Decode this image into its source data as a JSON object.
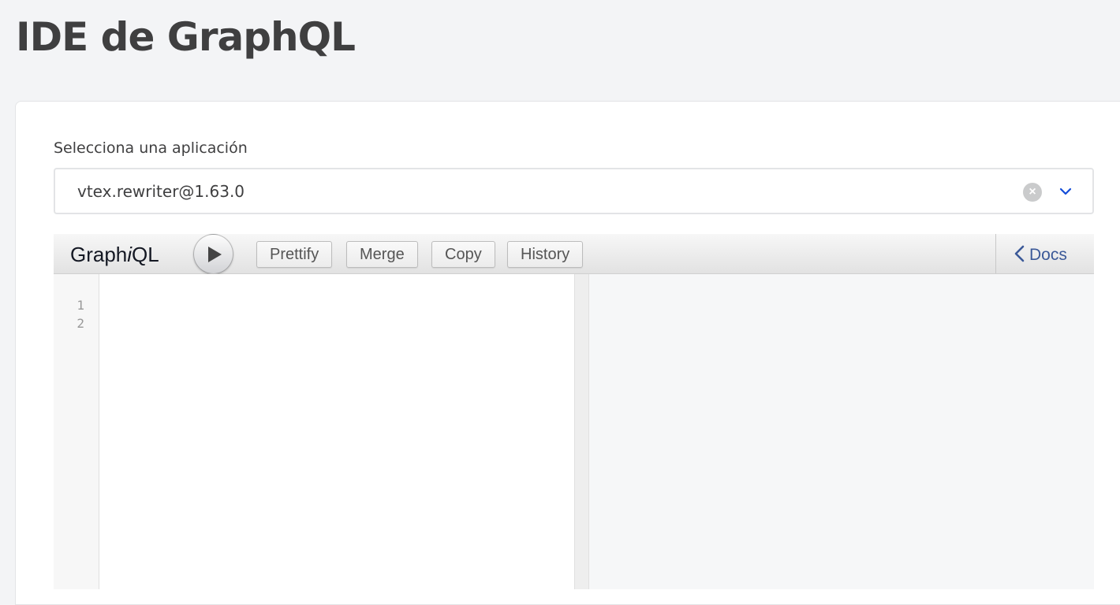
{
  "page": {
    "title": "IDE de GraphQL"
  },
  "app_select": {
    "label": "Selecciona una aplicación",
    "value": "vtex.rewriter@1.63.0",
    "clear_icon": "clear-circle-icon",
    "dropdown_icon": "chevron-down-icon"
  },
  "graphiql": {
    "logo_prefix": "Graph",
    "logo_italic": "i",
    "logo_suffix": "QL",
    "run_icon": "play-icon",
    "toolbar": {
      "prettify": "Prettify",
      "merge": "Merge",
      "copy": "Copy",
      "history": "History"
    },
    "docs_label": "Docs",
    "editor": {
      "line_numbers": [
        "1",
        "2"
      ]
    }
  },
  "colors": {
    "accent": "#134cd8",
    "docs_link": "#3b5998",
    "page_bg": "#f3f4f6"
  }
}
